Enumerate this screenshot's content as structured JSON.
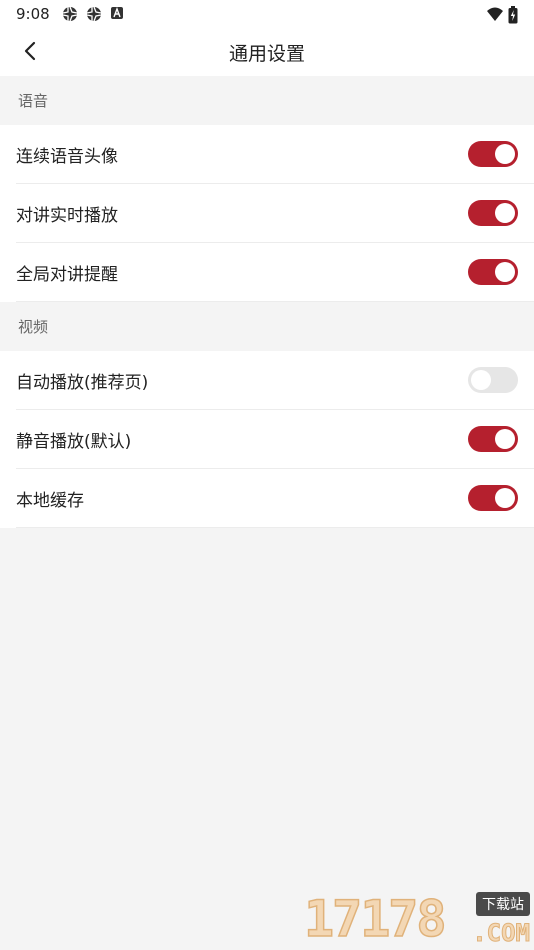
{
  "status_bar": {
    "time": "9:08",
    "icons": [
      "aperture-icon",
      "aperture-icon",
      "font-a-icon"
    ],
    "right_icons": [
      "wifi-icon",
      "battery-charging-icon"
    ]
  },
  "header": {
    "title": "通用设置",
    "back_icon": "chevron-left-icon"
  },
  "sections": [
    {
      "title": "语音",
      "items": [
        {
          "label": "连续语音头像",
          "enabled": true
        },
        {
          "label": "对讲实时播放",
          "enabled": true
        },
        {
          "label": "全局对讲提醒",
          "enabled": true
        }
      ]
    },
    {
      "title": "视频",
      "items": [
        {
          "label": "自动播放(推荐页)",
          "enabled": false
        },
        {
          "label": "静音播放(默认)",
          "enabled": true
        },
        {
          "label": "本地缓存",
          "enabled": true
        }
      ]
    }
  ],
  "watermark": {
    "digits": "17178",
    "badge": "下载站",
    "suffix": ".COM"
  },
  "colors": {
    "toggle_on": "#b5202e",
    "toggle_off": "#e6e6e6",
    "background": "#f4f4f4"
  }
}
